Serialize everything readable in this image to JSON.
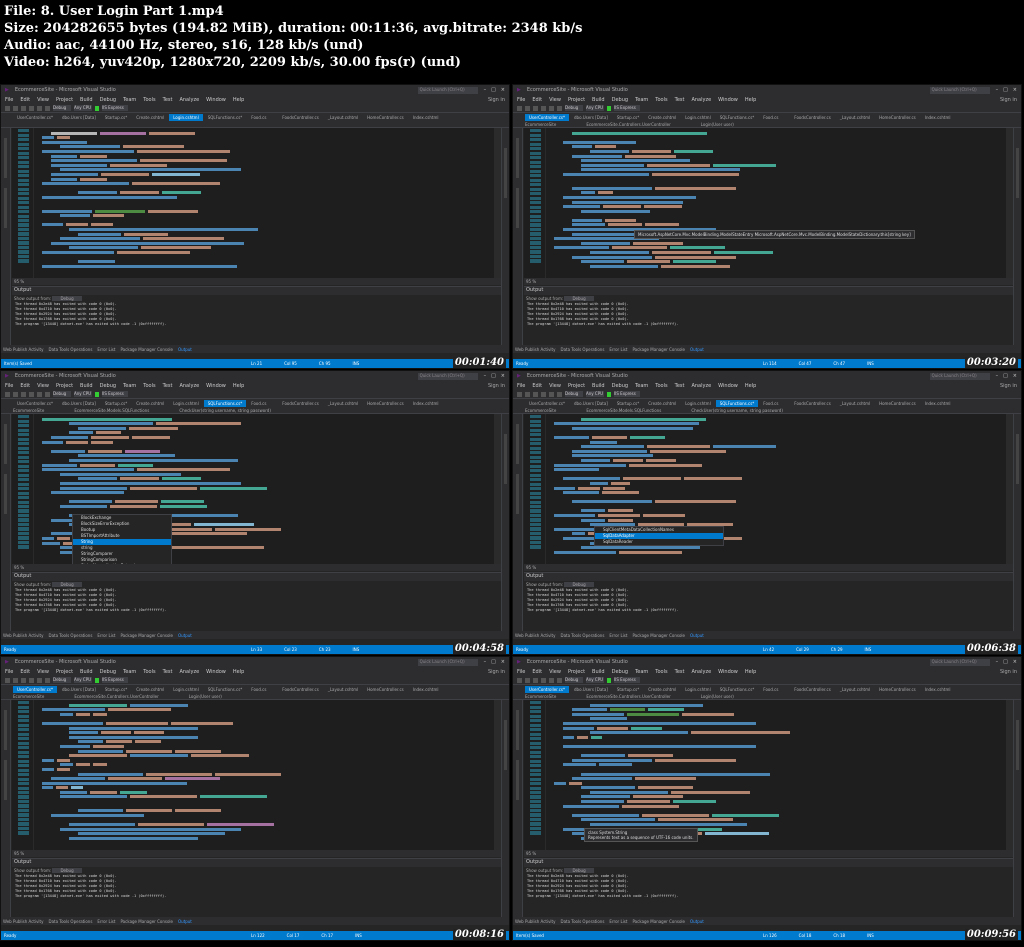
{
  "header": {
    "file": "File: 8. User Login Part 1.mp4",
    "size": "Size: 204282655 bytes (194.82 MiB), duration: 00:11:36, avg.bitrate: 2348 kb/s",
    "audio": "Audio: aac, 44100 Hz, stereo, s16, 128 kb/s (und)",
    "video": "Video: h264, yuv420p, 1280x720, 2209 kb/s, 30.00 fps(r) (und)"
  },
  "common": {
    "app_title": "EcommerceSite - Microsoft Visual Studio",
    "quick_launch": "Quick Launch (Ctrl+Q)",
    "sign_in": "Sign in",
    "menu": [
      "File",
      "Edit",
      "View",
      "Project",
      "Build",
      "Debug",
      "Team",
      "Tools",
      "Test",
      "Analyze",
      "Window",
      "Help"
    ],
    "toolbar_config": "Debug",
    "toolbar_platform": "Any CPU",
    "toolbar_run": "IIS Express",
    "zoom": "95 %",
    "output_title": "Output",
    "output_source_label": "Show output from:",
    "output_source_value": "Debug",
    "output_lines": [
      "The thread 0x2e48 has exited with code 0 (0x0).",
      "The thread 0x4710 has exited with code 0 (0x0).",
      "The thread 0x2924 has exited with code 0 (0x0).",
      "The thread 0x1768 has exited with code 0 (0x0).",
      "The program '[13448] dotnet.exe' has exited with code -1 (0xffffffff)."
    ],
    "bottom_tabs": [
      "Web Publish Activity",
      "Data Tools Operations",
      "Error List",
      "Package Manager Console",
      "Output"
    ],
    "status_ready": "Ready",
    "status_ins": "INS",
    "status_publish": "Add to Source Control"
  },
  "tiles": [
    {
      "timestamp": "00:01:40",
      "status_text": "Item(s) Saved",
      "ln": "Ln 21",
      "col": "Col 95",
      "ch": "Ch 95",
      "tabs": [
        "UserController.cs*",
        "dbo.Users [Data]",
        "Startup.cs*",
        "Create.cshtml",
        "Login.cshtml",
        "SQLFunctions.cs*",
        "Food.cs",
        "FoodsController.cs",
        "_Layout.cshtml",
        "HomeController.cs",
        "Index.cshtml"
      ],
      "active_tab": 4,
      "nav": [
        "",
        "",
        ""
      ]
    },
    {
      "timestamp": "00:03:20",
      "status_text": "Ready",
      "ln": "Ln 114",
      "col": "Col 47",
      "ch": "Ch 47",
      "tabs": [
        "UserController.cs*",
        "dbo.Users [Data]",
        "Startup.cs*",
        "Create.cshtml",
        "Login.cshtml",
        "SQLFunctions.cs*",
        "Food.cs",
        "FoodsController.cs",
        "_Layout.cshtml",
        "HomeController.cs",
        "Index.cshtml"
      ],
      "active_tab": 0,
      "nav": [
        "EcommerceSite",
        "EcommerceSite.Controllers.UserController",
        "Login(User user)"
      ],
      "tooltip": "Microsoft.AspNetCore.Mvc.ModelBinding.ModelStateEntry Microsoft.AspNetCore.Mvc.ModelBinding.ModelStateDictionary.this[string key]"
    },
    {
      "timestamp": "00:04:58",
      "status_text": "Ready",
      "ln": "Ln 33",
      "col": "Col 23",
      "ch": "Ch 23",
      "tabs": [
        "UserController.cs*",
        "dbo.Users [Data]",
        "Startup.cs*",
        "Create.cshtml",
        "Login.cshtml",
        "SQLFunctions.cs*",
        "Food.cs",
        "FoodsController.cs",
        "_Layout.cshtml",
        "HomeController.cs",
        "Index.cshtml"
      ],
      "active_tab": 5,
      "nav": [
        "EcommerceSite",
        "EcommerceSite.Models.SQLFunctions",
        "CheckUser(string username, string password)"
      ],
      "completion": [
        "BlockExchange",
        "BlockSizeErrorException",
        "Bootup",
        "BSTImportAttribute",
        "String",
        "string",
        "StringComparer",
        "StringComparison",
        "StringNormalizationExtensions"
      ],
      "completion_selected": 4
    },
    {
      "timestamp": "00:06:38",
      "status_text": "Ready",
      "ln": "Ln 42",
      "col": "Col 29",
      "ch": "Ch 29",
      "tabs": [
        "UserController.cs*",
        "dbo.Users [Data]",
        "Startup.cs*",
        "Create.cshtml",
        "Login.cshtml",
        "SQLFunctions.cs*",
        "Food.cs",
        "FoodsController.cs",
        "_Layout.cshtml",
        "HomeController.cs",
        "Index.cshtml"
      ],
      "active_tab": 5,
      "nav": [
        "EcommerceSite",
        "EcommerceSite.Models.SQLFunctions",
        "CheckUser(string username, string password)"
      ],
      "completion": [
        "SqlClientMetaDataCollectionNames",
        "SqlDataAdapter",
        "SqlDataReader"
      ],
      "completion_selected": 1
    },
    {
      "timestamp": "00:08:16",
      "status_text": "Ready",
      "ln": "Ln 122",
      "col": "Col 17",
      "ch": "Ch 17",
      "tabs": [
        "UserController.cs*",
        "dbo.Users [Data]",
        "Startup.cs*",
        "Create.cshtml",
        "Login.cshtml",
        "SQLFunctions.cs*",
        "Food.cs",
        "FoodsController.cs",
        "_Layout.cshtml",
        "HomeController.cs",
        "Index.cshtml"
      ],
      "active_tab": 0,
      "nav": [
        "EcommerceSite",
        "EcommerceSite.Controllers.UserController",
        "Login(User user)"
      ]
    },
    {
      "timestamp": "00:09:56",
      "status_text": "Item(s) Saved",
      "ln": "Ln 126",
      "col": "Col 18",
      "ch": "Ch 18",
      "tabs": [
        "UserController.cs*",
        "dbo.Users [Data]",
        "Startup.cs*",
        "Create.cshtml",
        "Login.cshtml",
        "SQLFunctions.cs*",
        "Food.cs",
        "FoodsController.cs",
        "_Layout.cshtml",
        "HomeController.cs",
        "Index.cshtml"
      ],
      "active_tab": 0,
      "nav": [
        "EcommerceSite",
        "EcommerceSite.Controllers.UserController",
        "Login(User user)"
      ],
      "tooltip": "class System.String",
      "tooltip2": "Represents text as a sequence of UTF-16 code units."
    }
  ],
  "colors": {
    "accent": "#007acc",
    "editor_bg": "#1e1e1e",
    "chrome": "#2d2d30"
  }
}
